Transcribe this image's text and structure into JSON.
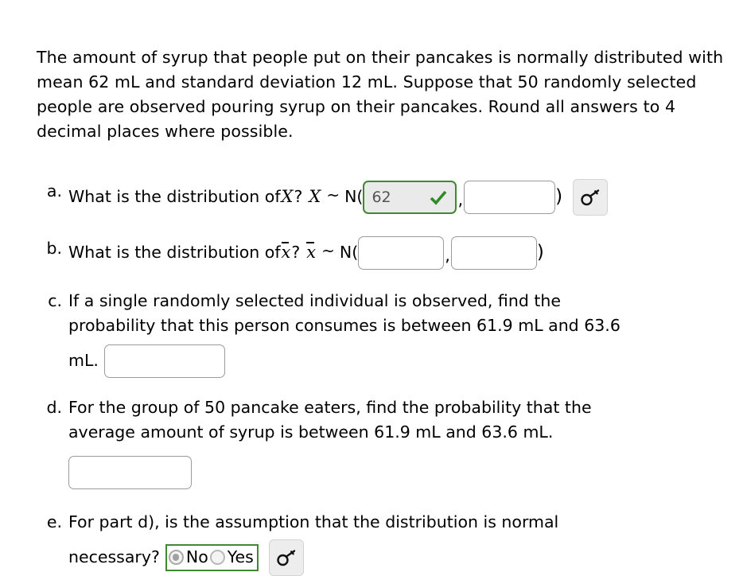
{
  "problem": {
    "intro": "The amount of syrup that people put on their pancakes is normally distributed with mean 62 mL and standard deviation 12 mL. Suppose that 50 randomly selected people are observed pouring syrup on their pancakes. Round all answers to 4 decimal places where possible.",
    "mean": "62",
    "standard_deviation": "12",
    "sample_size": "50",
    "lower_bound": "61.9",
    "upper_bound": "63.6"
  },
  "colors": {
    "correct_green": "#3f8a2e",
    "input_border": "#9a9a9a",
    "button_face": "#ededed",
    "filled_input_bg": "#eaeaea"
  },
  "parts": {
    "a": {
      "marker": "a.",
      "question": "What is the distribution of",
      "variable": "X",
      "question_mark": "?",
      "variable2": "X",
      "tilde": "~",
      "dist": "N(",
      "mean_value": "62",
      "mean_placeholder": "",
      "comma": ",",
      "sd_value": "",
      "sd_placeholder": "",
      "close_paren": ")",
      "check_icon": "check-icon",
      "key_icon": "key-icon"
    },
    "b": {
      "marker": "b.",
      "question": "What is the distribution of",
      "variable": "x̄",
      "question_mark": "?",
      "variable2": "x̄",
      "tilde": "~",
      "dist": "N(",
      "mean_value": "",
      "comma": ",",
      "sd_value": "",
      "close_paren": ")"
    },
    "c": {
      "marker": "c.",
      "line1": "If a single randomly selected individual is observed, find the",
      "line2": "probability that this person consumes is between 61.9 mL and 63.6",
      "unit": "mL.",
      "answer_value": ""
    },
    "d": {
      "marker": "d.",
      "line1": "For the group of 50 pancake eaters, find the probability that the",
      "line2": "average amount of syrup is between 61.9 mL and 63.6 mL.",
      "answer_value": ""
    },
    "e": {
      "marker": "e.",
      "line1": "For part d), is the assumption that the distribution is normal",
      "line2": "necessary?",
      "options": [
        {
          "label": "No",
          "selected": true
        },
        {
          "label": "Yes",
          "selected": false
        }
      ],
      "key_icon": "key-icon"
    }
  }
}
